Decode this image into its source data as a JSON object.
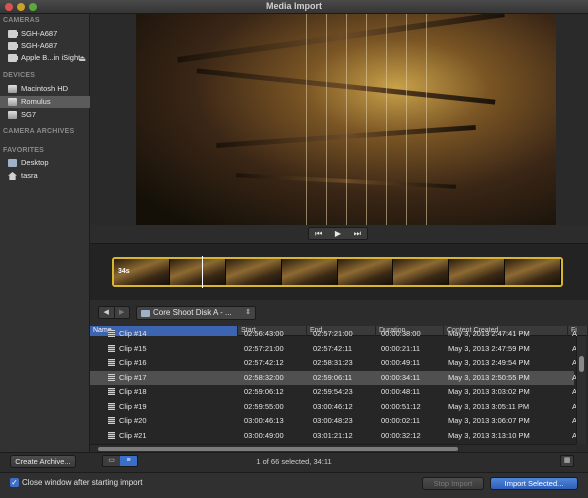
{
  "window": {
    "title": "Media Import"
  },
  "sidebar": {
    "sections": [
      {
        "heading": "CAMERAS",
        "items": [
          {
            "label": "SGH-A687",
            "icon": "camera-icon"
          },
          {
            "label": "SGH-A687",
            "icon": "camera-icon"
          },
          {
            "label": "Apple B...in iSight",
            "icon": "camera-icon",
            "eject": true
          }
        ]
      },
      {
        "heading": "DEVICES",
        "items": [
          {
            "label": "Macintosh HD",
            "icon": "hard-disk-icon"
          },
          {
            "label": "Romulus",
            "icon": "hard-disk-icon",
            "selected": true
          },
          {
            "label": "SG7",
            "icon": "hard-disk-icon"
          }
        ]
      },
      {
        "heading": "CAMERA ARCHIVES",
        "items": []
      },
      {
        "heading": "FAVORITES",
        "items": [
          {
            "label": "Desktop",
            "icon": "folder-icon"
          },
          {
            "label": "tasra",
            "icon": "home-icon"
          }
        ]
      }
    ],
    "create_archive_label": "Create Archive..."
  },
  "transport": {
    "prev": "⏮",
    "play": "▶",
    "next": "⏭"
  },
  "filmstrip": {
    "duration_badge": "34s"
  },
  "path": {
    "back": "◀",
    "forward": "▶",
    "current": "Core Shoot Disk A - ..."
  },
  "table": {
    "columns": [
      "Name",
      "Start",
      "End",
      "Duration",
      "Content Created",
      "Fi"
    ],
    "rows": [
      {
        "name": "Clip #14",
        "start": "02:56:43:00",
        "end": "02:57:21:00",
        "duration": "00:00:38:00",
        "created": "May 3, 2013 2:47:41 PM",
        "fi": "A"
      },
      {
        "name": "Clip #15",
        "start": "02:57:21:00",
        "end": "02:57:42:11",
        "duration": "00:00:21:11",
        "created": "May 3, 2013 2:47:59 PM",
        "fi": "A"
      },
      {
        "name": "Clip #16",
        "start": "02:57:42:12",
        "end": "02:58:31:23",
        "duration": "00:00:49:11",
        "created": "May 3, 2013 2:49:54 PM",
        "fi": "A"
      },
      {
        "name": "Clip #17",
        "start": "02:58:32:00",
        "end": "02:59:06:11",
        "duration": "00:00:34:11",
        "created": "May 3, 2013 2:50:55 PM",
        "fi": "A",
        "selected": true
      },
      {
        "name": "Clip #18",
        "start": "02:59:06:12",
        "end": "02:59:54:23",
        "duration": "00:00:48:11",
        "created": "May 3, 2013 3:03:02 PM",
        "fi": "A"
      },
      {
        "name": "Clip #19",
        "start": "02:59:55:00",
        "end": "03:00:46:12",
        "duration": "00:00:51:12",
        "created": "May 3, 2013 3:05:11 PM",
        "fi": "A"
      },
      {
        "name": "Clip #20",
        "start": "03:00:46:13",
        "end": "03:00:48:23",
        "duration": "00:00:02:11",
        "created": "May 3, 2013 3:06:07 PM",
        "fi": "A"
      },
      {
        "name": "Clip #21",
        "start": "03:00:49:00",
        "end": "03:01:21:12",
        "duration": "00:00:32:12",
        "created": "May 3, 2013 3:13:10 PM",
        "fi": "A"
      }
    ]
  },
  "status": {
    "text": "1 of 66 selected, 34:11"
  },
  "footer": {
    "close_window_checked": true,
    "close_window_label": "Close window after starting import",
    "stop_import_label": "Stop Import",
    "import_selected_label": "Import Selected..."
  },
  "colors": {
    "accent": "#3d6fc9",
    "filmstrip_border": "#d9b62f",
    "selection": "#505050"
  }
}
